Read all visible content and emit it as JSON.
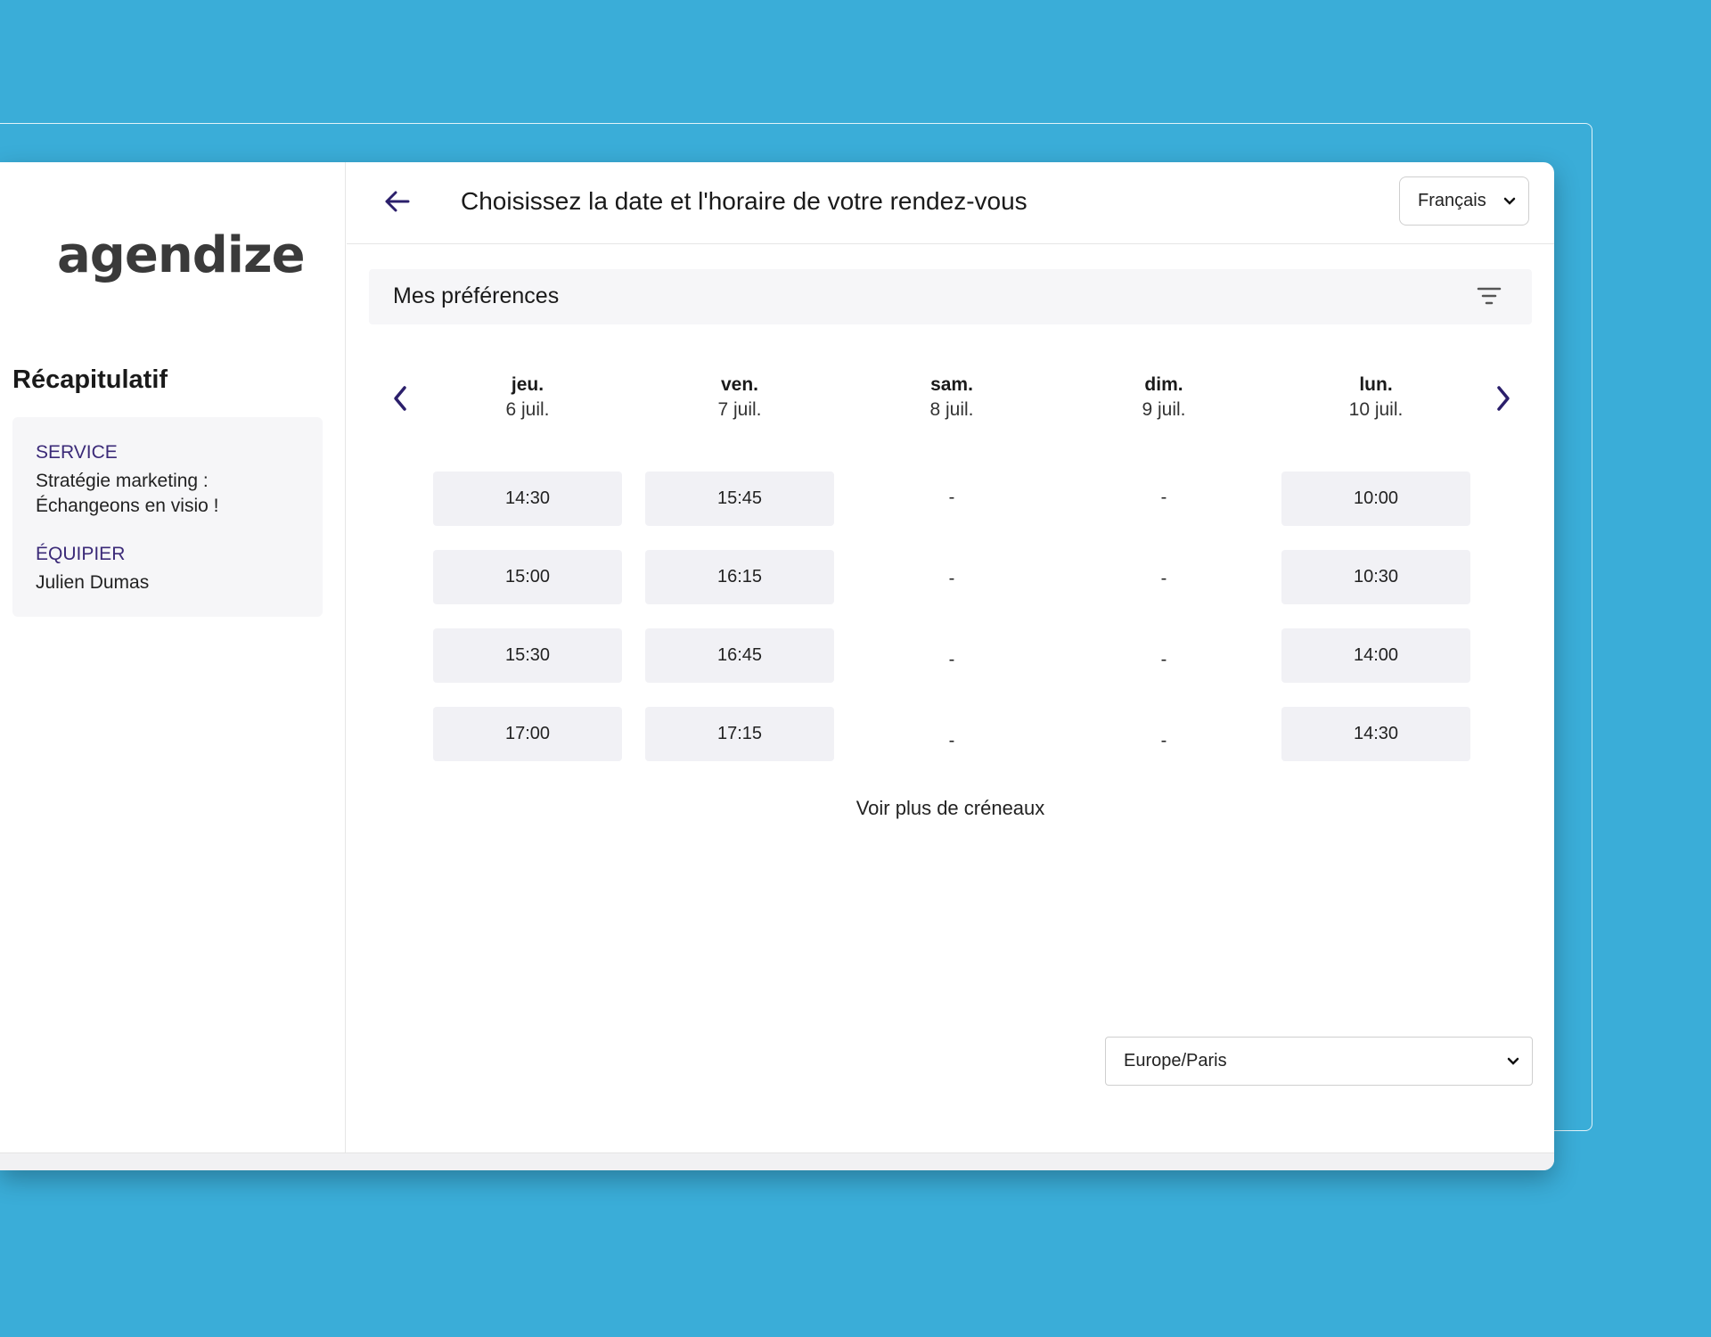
{
  "brand": {
    "logo_text": "agendize"
  },
  "sidebar": {
    "title": "Récapitulatif",
    "service_label": "SERVICE",
    "service_value": "Stratégie marketing : Échangeons en visio !",
    "staff_label": "ÉQUIPIER",
    "staff_value": "Julien Dumas"
  },
  "header": {
    "title": "Choisissez la date et l'horaire de votre rendez-vous",
    "language": "Français"
  },
  "preferences": {
    "label": "Mes préférences"
  },
  "calendar": {
    "days": [
      {
        "name": "jeu.",
        "date": "6 juil.",
        "slots": [
          "14:30",
          "15:00",
          "15:30",
          "17:00"
        ]
      },
      {
        "name": "ven.",
        "date": "7 juil.",
        "slots": [
          "15:45",
          "16:15",
          "16:45",
          "17:15"
        ]
      },
      {
        "name": "sam.",
        "date": "8 juil.",
        "slots": [
          "-",
          "-",
          "-",
          "-"
        ]
      },
      {
        "name": "dim.",
        "date": "9 juil.",
        "slots": [
          "-",
          "-",
          "-",
          "-"
        ]
      },
      {
        "name": "lun.",
        "date": "10 juil.",
        "slots": [
          "10:00",
          "10:30",
          "14:00",
          "14:30"
        ]
      }
    ],
    "more_label": "Voir plus de créneaux"
  },
  "timezone": {
    "value": "Europe/Paris"
  },
  "colors": {
    "background": "#3aadd8",
    "accent": "#2b1f6b",
    "slot_bg": "#f1f1f5"
  }
}
